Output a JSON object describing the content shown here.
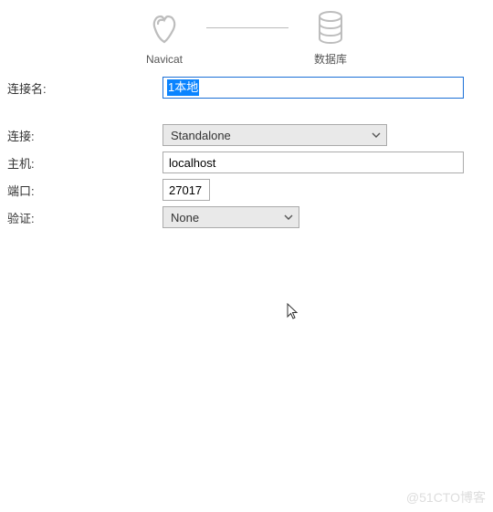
{
  "header": {
    "left_label": "Navicat",
    "right_label": "数据库"
  },
  "fields": {
    "name_label": "连接名:",
    "name_value": "1本地",
    "connection_label": "连接:",
    "connection_value": "Standalone",
    "host_label": "主机:",
    "host_value": "localhost",
    "port_label": "端口:",
    "port_value": "27017",
    "auth_label": "验证:",
    "auth_value": "None"
  },
  "watermark": "@51CTO博客"
}
